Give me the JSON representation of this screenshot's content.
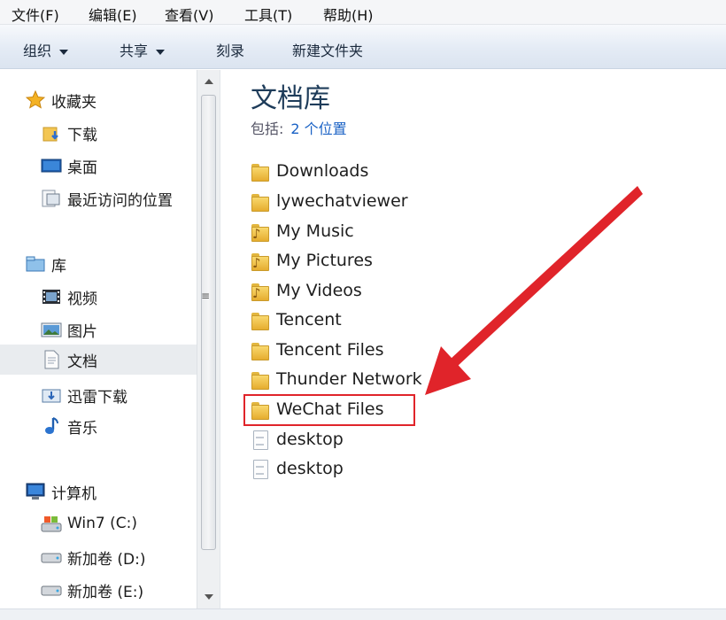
{
  "menu": [
    "文件(F)",
    "编辑(E)",
    "查看(V)",
    "工具(T)",
    "帮助(H)"
  ],
  "toolbar": {
    "organize": "组织",
    "share": "共享",
    "burn": "刻录",
    "new_folder": "新建文件夹"
  },
  "nav": {
    "favorites": {
      "label": "收藏夹",
      "items": [
        "下载",
        "桌面",
        "最近访问的位置"
      ]
    },
    "libraries": {
      "label": "库",
      "items": [
        "视频",
        "图片",
        "文档",
        "迅雷下载",
        "音乐"
      ],
      "selected": "文档"
    },
    "computer": {
      "label": "计算机",
      "items": [
        "Win7 (C:)",
        "新加卷 (D:)",
        "新加卷 (E:)"
      ]
    }
  },
  "library": {
    "title": "文档库",
    "includes_label": "包括:",
    "includes_link": "2 个位置"
  },
  "files": [
    {
      "name": "Downloads",
      "icon": "folder-icon"
    },
    {
      "name": "lywechatviewer",
      "icon": "folder-icon"
    },
    {
      "name": "My Music",
      "icon": "music-folder-icon"
    },
    {
      "name": "My Pictures",
      "icon": "picture-folder-icon"
    },
    {
      "name": "My Videos",
      "icon": "video-folder-icon"
    },
    {
      "name": "Tencent",
      "icon": "folder-icon"
    },
    {
      "name": "Tencent Files",
      "icon": "folder-icon"
    },
    {
      "name": "Thunder Network",
      "icon": "folder-icon"
    },
    {
      "name": "WeChat Files",
      "icon": "folder-icon",
      "highlighted": true
    },
    {
      "name": "desktop",
      "icon": "settings-file-icon"
    },
    {
      "name": "desktop",
      "icon": "settings-file-icon"
    }
  ],
  "colors": {
    "annotation": "#e0242a",
    "link": "#1a62c5",
    "title": "#1e3c5a"
  }
}
